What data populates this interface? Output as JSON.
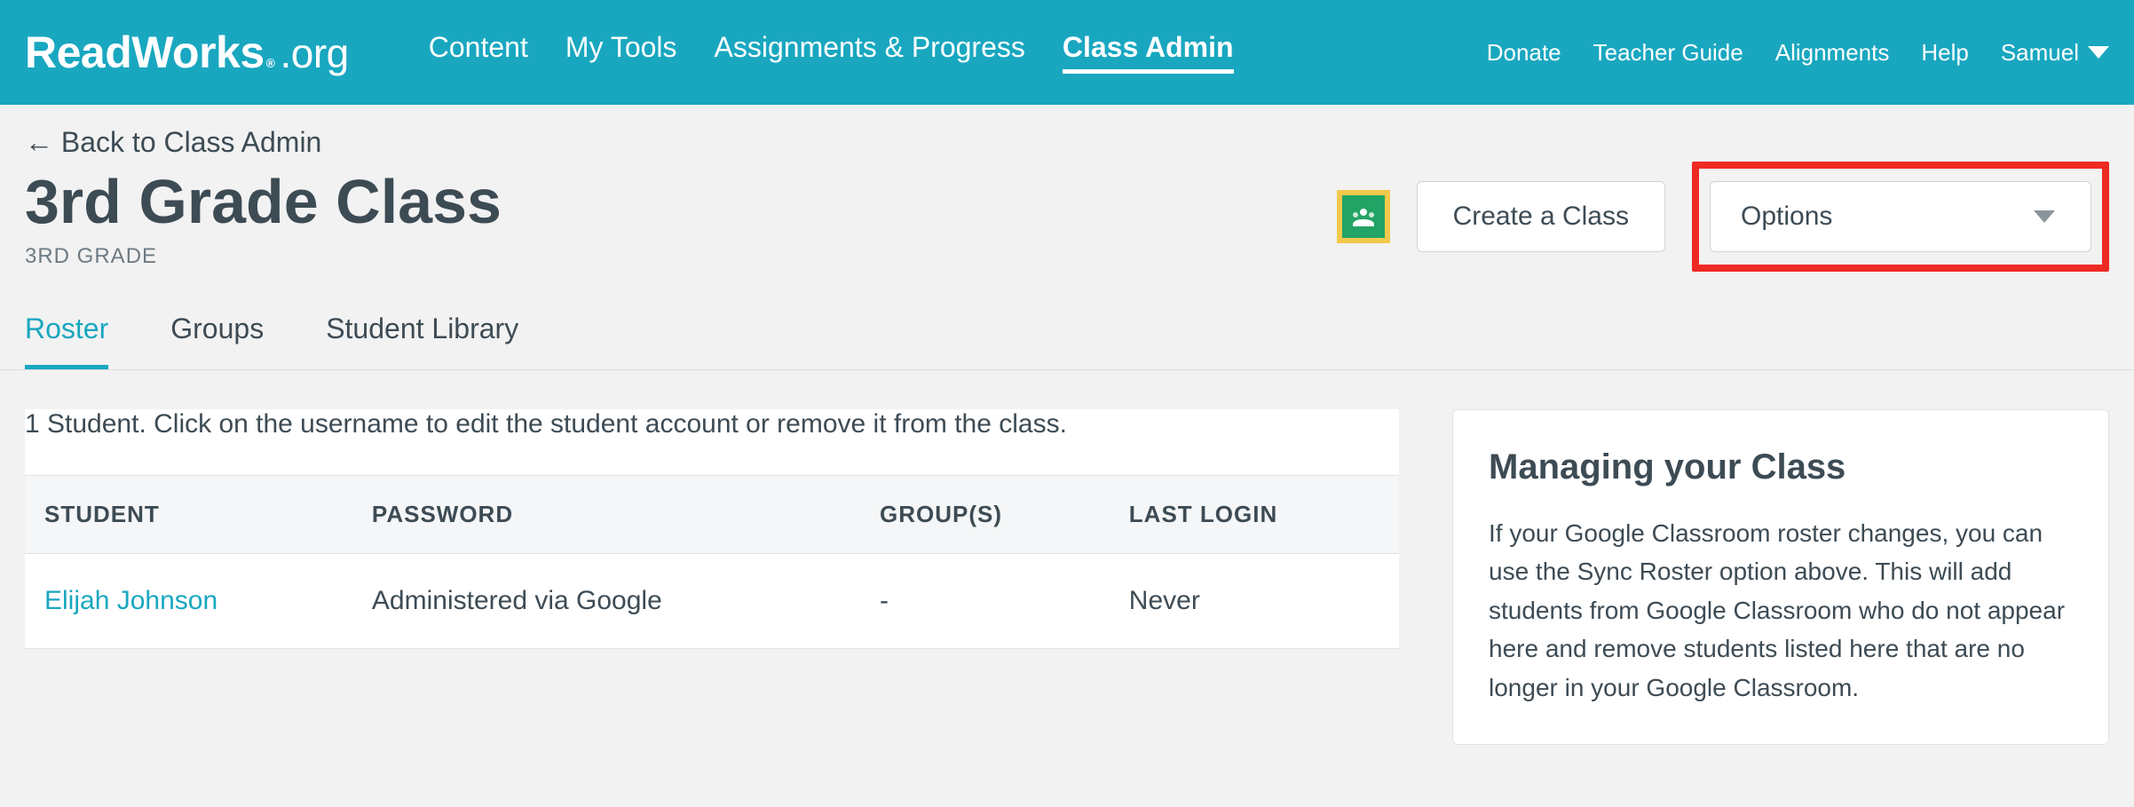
{
  "nav": {
    "logo_bold": "ReadWorks",
    "logo_org": ".org",
    "items": [
      "Content",
      "My Tools",
      "Assignments & Progress",
      "Class Admin"
    ],
    "active_index": 3,
    "right_items": [
      "Donate",
      "Teacher Guide",
      "Alignments",
      "Help"
    ],
    "user_name": "Samuel"
  },
  "page": {
    "back_label": "← Back to Class Admin",
    "title": "3rd Grade Class",
    "subtitle": "3RD GRADE",
    "create_class_label": "Create a Class",
    "options_label": "Options"
  },
  "tabs": {
    "items": [
      "Roster",
      "Groups",
      "Student Library"
    ],
    "active_index": 0
  },
  "roster": {
    "help_text": "1 Student. Click on the username to edit the student account or remove it from the class.",
    "columns": [
      "STUDENT",
      "PASSWORD",
      "GROUP(S)",
      "LAST LOGIN"
    ],
    "rows": [
      {
        "student": "Elijah Johnson",
        "password": "Administered via Google",
        "groups": "-",
        "last_login": "Never"
      }
    ]
  },
  "sidebar": {
    "title": "Managing your Class",
    "body": "If your Google Classroom roster changes, you can use the Sync Roster option above. This will add students from Google Classroom who do not appear here and remove students listed here that are no longer in your Google Classroom."
  }
}
